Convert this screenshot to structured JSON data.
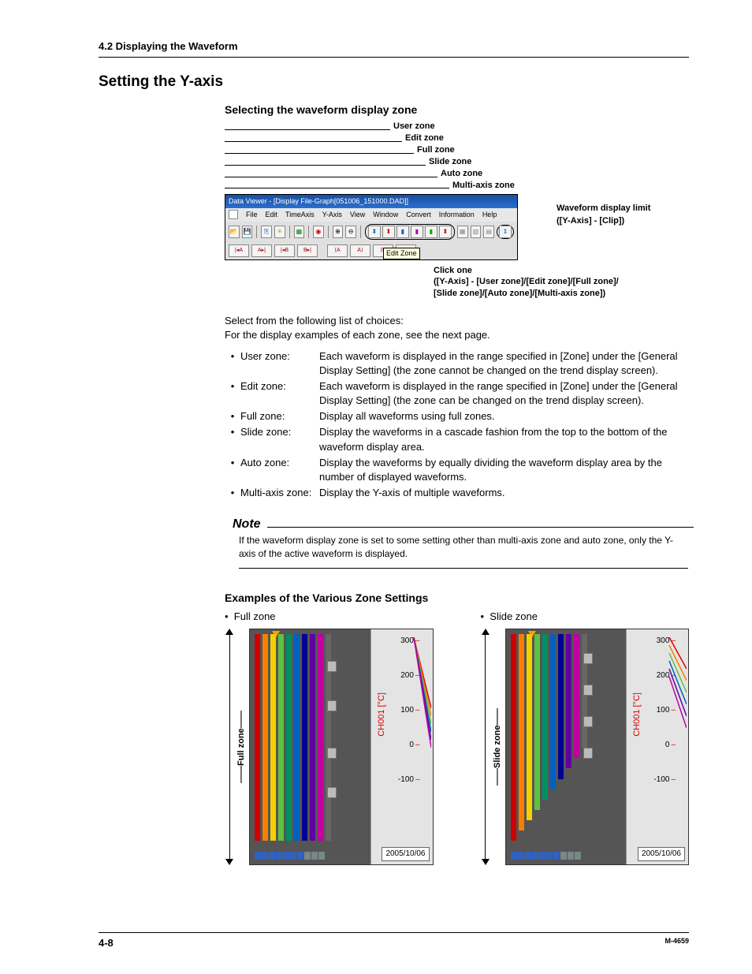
{
  "header": "4.2  Displaying the Waveform",
  "h1": "Setting the Y-axis",
  "h2a": "Selecting the waveform display zone",
  "callouts": {
    "c1": "User zone",
    "c2": "Edit zone",
    "c3": "Full zone",
    "c4": "Slide zone",
    "c5": "Auto zone",
    "c6": "Multi-axis zone",
    "right1": "Waveform display limit",
    "right2": "([Y-Axis] - [Clip])",
    "b1": "Click one",
    "b2": "([Y-Axis] - [User zone]/[Edit zone]/[Full zone]/",
    "b3": "[Slide zone]/[Auto zone]/[Multi-axis zone])"
  },
  "win": {
    "title": "Data Viewer - [Display File-Graph[051006_151000.DAD]]",
    "menu": [
      "File",
      "Edit",
      "TimeAxis",
      "Y-Axis",
      "View",
      "Window",
      "Convert",
      "Information",
      "Help"
    ],
    "tooltip": "Edit Zone"
  },
  "intro1": "Select from the following list of choices:",
  "intro2": "For the display examples of each zone, see the next page.",
  "defs": [
    {
      "term": "User zone:",
      "desc": "Each waveform is displayed in the range specified in [Zone] under the [General Display Setting] (the zone cannot be changed on the trend display screen)."
    },
    {
      "term": "Edit zone:",
      "desc": "Each waveform is displayed in the range specified in [Zone] under the [General Display Setting] (the zone can be changed on the trend display screen)."
    },
    {
      "term": "Full zone:",
      "desc": "Display all waveforms using full zones."
    },
    {
      "term": "Slide zone:",
      "desc": "Display the waveforms in a cascade fashion from the top to the bottom of the waveform display area."
    },
    {
      "term": "Auto zone:",
      "desc": "Display the waveforms by equally dividing the waveform display area by the number of displayed waveforms."
    },
    {
      "term": "Multi-axis zone:",
      "desc": "Display the Y-axis of multiple waveforms."
    }
  ],
  "note": {
    "title": "Note",
    "body": "If the waveform display zone is set to some setting other than multi-axis zone and auto zone, only the Y-axis of the active waveform is displayed."
  },
  "examples": {
    "heading": "Examples of the Various Zone Settings",
    "left_label": "Full zone",
    "right_label": "Slide zone",
    "vleft": "Full zone",
    "vright": "Slide zone",
    "axis_label": "CH001 [°C]",
    "date": "2005/10/06",
    "ticks_full": [
      "300",
      "200",
      "100",
      "0",
      "-100"
    ],
    "ticks_slide": [
      "300",
      "200",
      "100",
      "0",
      "-100"
    ]
  },
  "bar_colors": [
    "#d00000",
    "#f58000",
    "#f5d000",
    "#60c040",
    "#009060",
    "#0060c0",
    "#000090",
    "#6000a0",
    "#c000a0",
    "#666"
  ],
  "footer": {
    "page": "4-8",
    "doc": "M-4659"
  }
}
